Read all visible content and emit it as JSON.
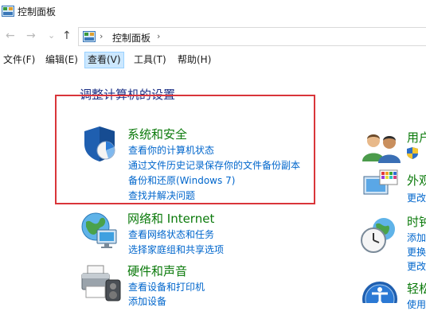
{
  "window": {
    "title": "控制面板"
  },
  "nav": {
    "back": "←",
    "forward": "→",
    "recent": "⌄",
    "up": "↑"
  },
  "address": {
    "separator1": "›",
    "crumb": "控制面板",
    "separator2": "›"
  },
  "menu": [
    "文件(F)",
    "编辑(E)",
    "查看(V)",
    "工具(T)",
    "帮助(H)"
  ],
  "heading": "调整计算机的设置",
  "categories": [
    {
      "title": "系统和安全",
      "icon": "shield-icon",
      "links": [
        "查看你的计算机状态",
        "通过文件历史记录保存你的文件备份副本",
        "备份和还原(Windows 7)",
        "查找并解决问题"
      ]
    },
    {
      "title": "网络和 Internet",
      "icon": "network-globe-icon",
      "links": [
        "查看网络状态和任务",
        "选择家庭组和共享选项"
      ]
    },
    {
      "title": "硬件和声音",
      "icon": "printer-icon",
      "links": [
        "查看设备和打印机",
        "添加设备"
      ]
    }
  ],
  "right_column": [
    {
      "title": "用户",
      "icon": "users-icon",
      "links": []
    },
    {
      "title": "外观",
      "icon": "appearance-icon",
      "links": [
        "更改"
      ]
    },
    {
      "title": "时钟",
      "icon": "clock-globe-icon",
      "links": [
        "添加",
        "更换",
        "更改"
      ]
    },
    {
      "title": "轻松",
      "icon": "ease-of-access-icon",
      "links": [
        "使用"
      ]
    }
  ],
  "colors": {
    "category_title": "#0b7a0b",
    "link": "#0066cc",
    "heading": "#1e3287",
    "highlight": "#d9353a"
  }
}
